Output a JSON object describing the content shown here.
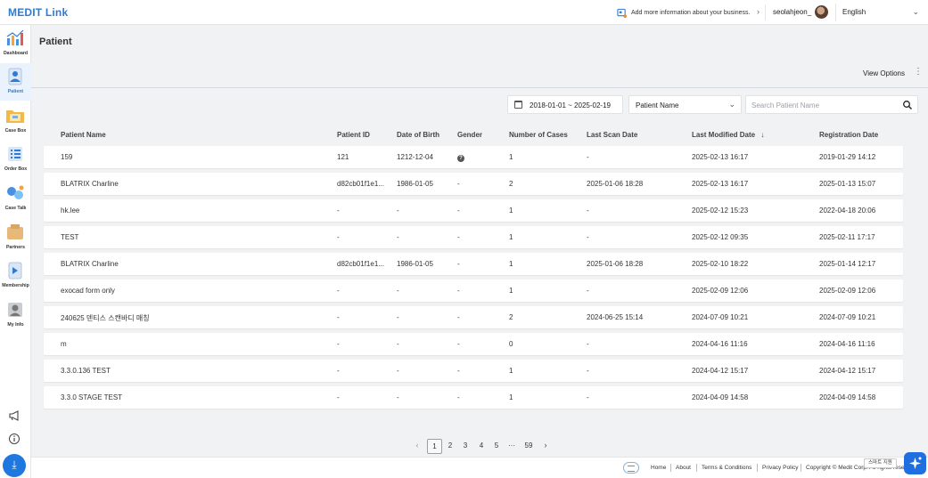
{
  "app": {
    "logo": "MEDIT Link",
    "page_title": "Patient"
  },
  "header": {
    "banner_text": "Add more information about your business.",
    "username": "seolahjeon_",
    "language": "English"
  },
  "sidebar": {
    "items": [
      {
        "label": "Dashboard",
        "icon": "dashboard-icon"
      },
      {
        "label": "Patient",
        "icon": "patient-icon",
        "active": true
      },
      {
        "label": "Case Box",
        "icon": "case-box-icon"
      },
      {
        "label": "Order Box",
        "icon": "order-box-icon"
      },
      {
        "label": "Case Talk",
        "icon": "case-talk-icon"
      },
      {
        "label": "Partners",
        "icon": "partners-icon"
      },
      {
        "label": "Membership",
        "icon": "membership-icon"
      },
      {
        "label": "My Info",
        "icon": "my-info-icon"
      }
    ]
  },
  "toolbar": {
    "view_options": "View Options"
  },
  "filters": {
    "date_range": "2018-01-01 ~ 2025-02-19",
    "search_field": "Patient Name",
    "search_placeholder": "Search Patient Name"
  },
  "table": {
    "columns": [
      "Patient Name",
      "Patient ID",
      "Date of Birth",
      "Gender",
      "Number of Cases",
      "Last Scan Date",
      "Last Modified Date",
      "Registration Date"
    ],
    "rows": [
      {
        "name": "159",
        "id": "121",
        "dob": "1212-12-04",
        "gender": "?",
        "cases": "1",
        "last_scan": "-",
        "last_modified": "2025-02-13 16:17",
        "registration": "2019-01-29 14:12"
      },
      {
        "name": "BLATRIX Charline",
        "id": "d82cb01f1e1...",
        "dob": "1986-01-05",
        "gender": "-",
        "cases": "2",
        "last_scan": "2025-01-06 18:28",
        "last_modified": "2025-02-13 16:17",
        "registration": "2025-01-13 15:07"
      },
      {
        "name": "hk.lee",
        "id": "-",
        "dob": "-",
        "gender": "-",
        "cases": "1",
        "last_scan": "-",
        "last_modified": "2025-02-12 15:23",
        "registration": "2022-04-18 20:06"
      },
      {
        "name": "TEST",
        "id": "-",
        "dob": "-",
        "gender": "-",
        "cases": "1",
        "last_scan": "-",
        "last_modified": "2025-02-12 09:35",
        "registration": "2025-02-11 17:17"
      },
      {
        "name": "BLATRIX Charline",
        "id": "d82cb01f1e1...",
        "dob": "1986-01-05",
        "gender": "-",
        "cases": "1",
        "last_scan": "2025-01-06 18:28",
        "last_modified": "2025-02-10 18:22",
        "registration": "2025-01-14 12:17"
      },
      {
        "name": "exocad form only",
        "id": "-",
        "dob": "-",
        "gender": "-",
        "cases": "1",
        "last_scan": "-",
        "last_modified": "2025-02-09 12:06",
        "registration": "2025-02-09 12:06"
      },
      {
        "name": "240625 덴티스 스캔바디 매칭",
        "id": "-",
        "dob": "-",
        "gender": "-",
        "cases": "2",
        "last_scan": "2024-06-25 15:14",
        "last_modified": "2024-07-09 10:21",
        "registration": "2024-07-09 10:21"
      },
      {
        "name": "m",
        "id": "-",
        "dob": "-",
        "gender": "-",
        "cases": "0",
        "last_scan": "-",
        "last_modified": "2024-04-16 11:16",
        "registration": "2024-04-16 11:16"
      },
      {
        "name": "3.3.0.136 TEST",
        "id": "-",
        "dob": "-",
        "gender": "-",
        "cases": "1",
        "last_scan": "-",
        "last_modified": "2024-04-12 15:17",
        "registration": "2024-04-12 15:17"
      },
      {
        "name": "3.3.0 STAGE TEST",
        "id": "-",
        "dob": "-",
        "gender": "-",
        "cases": "1",
        "last_scan": "-",
        "last_modified": "2024-04-09 14:58",
        "registration": "2024-04-09 14:58"
      }
    ]
  },
  "pagination": {
    "prev": "‹",
    "pages": [
      "1",
      "2",
      "3",
      "4",
      "5"
    ],
    "ellipsis": "···",
    "last": "59",
    "next": "›",
    "current": "1"
  },
  "footer": {
    "links": [
      "Home",
      "About",
      "Terms & Conditions",
      "Privacy Policy"
    ],
    "copyright": "Copyright © Medit Corp. All rights reserved.",
    "smart_support": "스마트 지원"
  },
  "colors": {
    "brand": "#2e7bd6",
    "primary_button": "#1f77e0"
  }
}
